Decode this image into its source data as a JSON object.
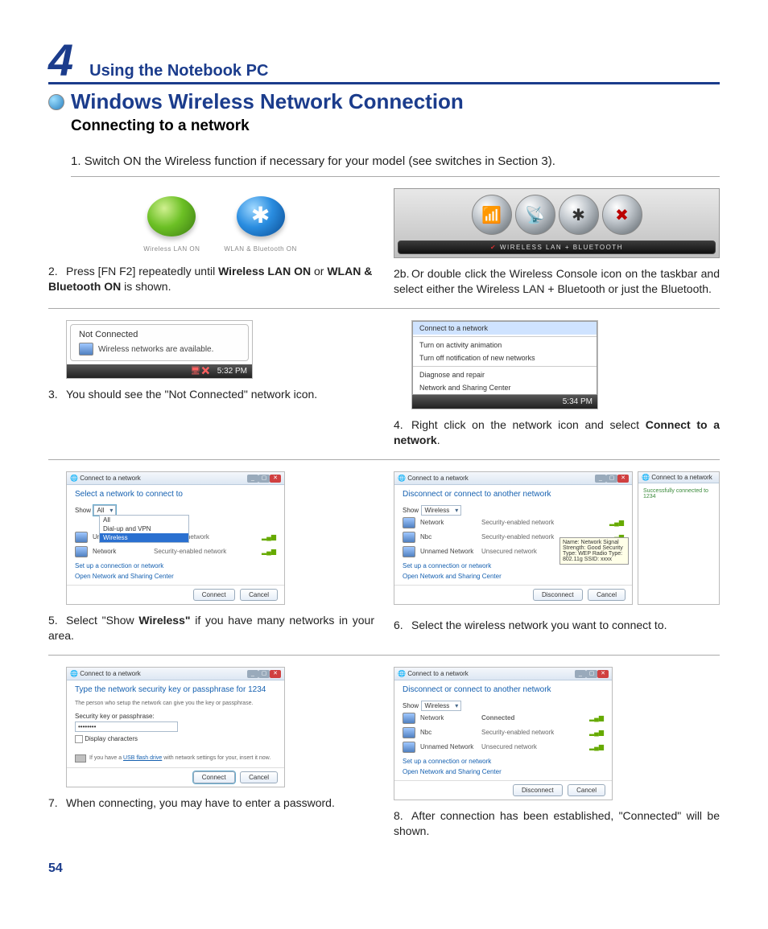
{
  "chapter": {
    "number": "4",
    "title": "Using the Notebook PC"
  },
  "section": "Windows Wireless Network Connection",
  "subsection": "Connecting to a network",
  "page_number": "54",
  "steps": {
    "s1": {
      "n": "1.",
      "text": "Switch ON the Wireless function if necessary for your model (see switches in Section 3)."
    },
    "s2": {
      "n": "2.",
      "pre": "Press [FN F2] repeatedly until ",
      "b1": "Wireless LAN ON",
      "mid": " or ",
      "b2": "WLAN & Bluetooth ON",
      "post": " is shown."
    },
    "s2b": {
      "n": "2b.",
      "text": "Or double click the Wireless Console icon on the taskbar and select either the Wireless LAN + Bluetooth or just the Bluetooth."
    },
    "s3": {
      "n": "3.",
      "text": "You should see the \"Not Connected\" network icon."
    },
    "s4": {
      "n": "4.",
      "pre": "Right click on the network icon and select ",
      "b1": "Connect to a network",
      "post": "."
    },
    "s5": {
      "n": "5.",
      "pre": "Select \"Show ",
      "b1": "Wireless\"",
      "post": " if you have many networks in your area."
    },
    "s6": {
      "n": "6.",
      "text": "Select the wireless network you want to connect to."
    },
    "s7": {
      "n": "7.",
      "text": "When connecting, you may have to enter a password."
    },
    "s8": {
      "n": "8.",
      "text": "After connection has been established, \"Connected\" will be shown."
    }
  },
  "fig2": {
    "cap1": "Wireless LAN ON",
    "cap2": "WLAN & Bluetooth ON"
  },
  "fig2b": {
    "strip": "WIRELESS LAN + BLUETOOTH"
  },
  "fig3": {
    "title": "Not Connected",
    "msg": "Wireless networks are available.",
    "time": "5:32 PM"
  },
  "fig4": {
    "m1": "Connect to a network",
    "m2": "Turn on activity animation",
    "m3": "Turn off notification of new networks",
    "m4": "Diagnose and repair",
    "m5": "Network and Sharing Center",
    "time": "5:34 PM"
  },
  "dlg": {
    "title": "Connect to a network",
    "select_head": "Select a network to connect to",
    "disconnect_head": "Disconnect or connect to another network",
    "show": "Show",
    "wireless": "Wireless",
    "all": "All",
    "dialup": "Dial-up and VPN",
    "net_network": "Network",
    "net_unnamed": "Unnamed Network",
    "net_nbc": "Nbc",
    "sec_enabled": "Security-enabled network",
    "sec_unsecured": "Unsecured network",
    "connected": "Connected",
    "link1": "Set up a connection or network",
    "link2": "Open Network and Sharing Center",
    "btn_connect": "Connect",
    "btn_cancel": "Cancel",
    "btn_disconnect": "Disconnect",
    "pw_head": "Type the network security key or passphrase for 1234",
    "pw_sub": "The person who setup the network can give you the key or passphrase.",
    "pw_label": "Security key or passphrase:",
    "pw_value": "••••••••",
    "pw_chk": "Display characters",
    "usb_pre": "If you have a ",
    "usb_link": "USB flash drive",
    "usb_post": " with network settings for your, insert it now.",
    "side_status": "Successfully connected to 1234",
    "tooltip": "Name: Network\nSignal Strength: Good\nSecurity Type: WEP\nRadio Type: 802.11g\nSSID: xxxx"
  }
}
